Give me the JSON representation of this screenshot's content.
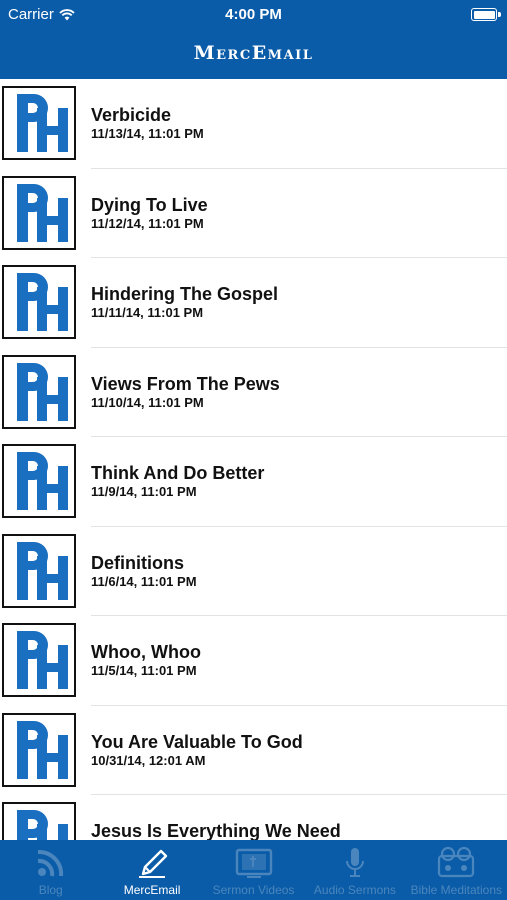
{
  "status_bar": {
    "carrier": "Carrier",
    "time": "4:00 PM"
  },
  "nav": {
    "title": "MercEmail"
  },
  "colors": {
    "brand_blue": "#0b5ca8",
    "logo_blue": "#1a6fc0",
    "tab_inactive": "#4a86bd",
    "tab_active": "#ffffff"
  },
  "items": [
    {
      "title": "Verbicide",
      "date": "11/13/14, 11:01 PM",
      "icon": "ph-logo-icon"
    },
    {
      "title": "Dying To Live",
      "date": "11/12/14, 11:01 PM",
      "icon": "ph-logo-icon"
    },
    {
      "title": "Hindering The Gospel",
      "date": "11/11/14, 11:01 PM",
      "icon": "ph-logo-icon"
    },
    {
      "title": "Views From The Pews",
      "date": "11/10/14, 11:01 PM",
      "icon": "ph-logo-icon"
    },
    {
      "title": "Think And Do Better",
      "date": "11/9/14, 11:01 PM",
      "icon": "ph-logo-icon"
    },
    {
      "title": "Definitions",
      "date": "11/6/14, 11:01 PM",
      "icon": "ph-logo-icon"
    },
    {
      "title": "Whoo, Whoo",
      "date": "11/5/14, 11:01 PM",
      "icon": "ph-logo-icon"
    },
    {
      "title": "You Are Valuable To God",
      "date": "10/31/14, 12:01 AM",
      "icon": "ph-logo-icon"
    },
    {
      "title": "Jesus Is Everything We Need",
      "date": "",
      "icon": "ph-logo-icon"
    }
  ],
  "tabs": [
    {
      "label": "Blog",
      "icon": "rss-icon",
      "active": false
    },
    {
      "label": "MercEmail",
      "icon": "pencil-icon",
      "active": true
    },
    {
      "label": "Sermon Videos",
      "icon": "video-screen-icon",
      "active": false
    },
    {
      "label": "Audio Sermons",
      "icon": "microphone-icon",
      "active": false
    },
    {
      "label": "Bible Meditations",
      "icon": "reel-to-reel-icon",
      "active": false
    }
  ]
}
